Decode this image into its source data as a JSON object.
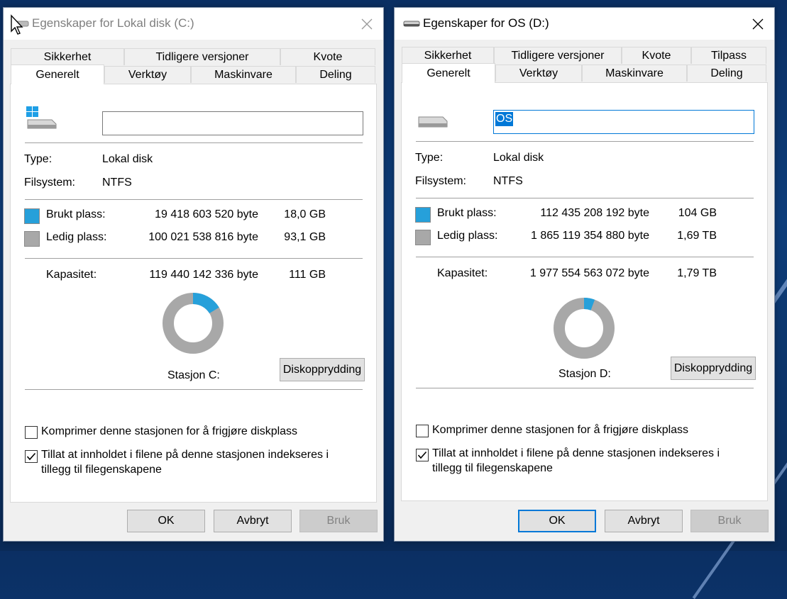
{
  "dialogs": [
    {
      "title": "Egenskaper for Lokal disk (C:)",
      "tabs_row1": [
        "Sikkerhet",
        "Tidligere versjoner",
        "Kvote"
      ],
      "tabs_row2": [
        "Generelt",
        "Verktøy",
        "Maskinvare",
        "Deling"
      ],
      "name_value": "",
      "type_label": "Type:",
      "type_value": "Lokal disk",
      "fs_label": "Filsystem:",
      "fs_value": "NTFS",
      "used_label": "Brukt plass:",
      "used_bytes": "19 418 603 520 byte",
      "used_size": "18,0 GB",
      "free_label": "Ledig plass:",
      "free_bytes": "100 021 538 816 byte",
      "free_size": "93,1 GB",
      "cap_label": "Kapasitet:",
      "cap_bytes": "119 440 142 336 byte",
      "cap_size": "111 GB",
      "used_fraction": 0.163,
      "drive_label": "Stasjon C:",
      "cleanup_label": "Diskopprydding",
      "compress_label": "Komprimer denne stasjonen for å frigjøre diskplass",
      "compress_checked": false,
      "index_label_line1": "Tillat at innholdet i filene på denne stasjonen indekseres i",
      "index_label_line2": "tillegg til filegenskapene",
      "index_checked": true,
      "ok_label": "OK",
      "cancel_label": "Avbryt",
      "apply_label": "Bruk",
      "active": false,
      "icon": "windows-drive-icon"
    },
    {
      "title": "Egenskaper for OS (D:)",
      "tabs_row1": [
        "Sikkerhet",
        "Tidligere versjoner",
        "Kvote",
        "Tilpass"
      ],
      "tabs_row2": [
        "Generelt",
        "Verktøy",
        "Maskinvare",
        "Deling"
      ],
      "name_value": "OS",
      "type_label": "Type:",
      "type_value": "Lokal disk",
      "fs_label": "Filsystem:",
      "fs_value": "NTFS",
      "used_label": "Brukt plass:",
      "used_bytes": "112 435 208 192 byte",
      "used_size": "104 GB",
      "free_label": "Ledig plass:",
      "free_bytes": "1 865 119 354 880 byte",
      "free_size": "1,69 TB",
      "cap_label": "Kapasitet:",
      "cap_bytes": "1 977 554 563 072 byte",
      "cap_size": "1,79 TB",
      "used_fraction": 0.057,
      "drive_label": "Stasjon D:",
      "cleanup_label": "Diskopprydding",
      "compress_label": "Komprimer denne stasjonen for å frigjøre diskplass",
      "compress_checked": false,
      "index_label_line1": "Tillat at innholdet i filene på denne stasjonen indekseres i",
      "index_label_line2": "tillegg til filegenskapene",
      "index_checked": true,
      "ok_label": "OK",
      "cancel_label": "Avbryt",
      "apply_label": "Bruk",
      "active": true,
      "icon": "drive-icon"
    }
  ],
  "colors": {
    "used": "#26a0da",
    "free": "#a8a8a8",
    "accent": "#0078d7"
  }
}
